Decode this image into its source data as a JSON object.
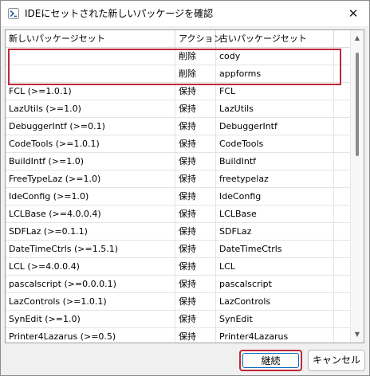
{
  "window": {
    "title": "IDEにセットされた新しいパッケージを確認",
    "close_glyph": "✕"
  },
  "table": {
    "headers": [
      "新しいパッケージセット",
      "アクション",
      "古いパッケージセット"
    ],
    "rows": [
      {
        "new": "",
        "action": "削除",
        "old": "cody"
      },
      {
        "new": "",
        "action": "削除",
        "old": "appforms"
      },
      {
        "new": "FCL (>=1.0.1)",
        "action": "保持",
        "old": "FCL"
      },
      {
        "new": "LazUtils (>=1.0)",
        "action": "保持",
        "old": "LazUtils"
      },
      {
        "new": "DebuggerIntf (>=0.1)",
        "action": "保持",
        "old": "DebuggerIntf"
      },
      {
        "new": "CodeTools (>=1.0.1)",
        "action": "保持",
        "old": "CodeTools"
      },
      {
        "new": "BuildIntf (>=1.0)",
        "action": "保持",
        "old": "BuildIntf"
      },
      {
        "new": "FreeTypeLaz (>=1.0)",
        "action": "保持",
        "old": "freetypelaz"
      },
      {
        "new": "IdeConfig (>=1.0)",
        "action": "保持",
        "old": "IdeConfig"
      },
      {
        "new": "LCLBase (>=4.0.0.4)",
        "action": "保持",
        "old": "LCLBase"
      },
      {
        "new": "SDFLaz (>=0.1.1)",
        "action": "保持",
        "old": "SDFLaz"
      },
      {
        "new": "DateTimeCtrls (>=1.5.1)",
        "action": "保持",
        "old": "DateTimeCtrls"
      },
      {
        "new": "LCL (>=4.0.0.4)",
        "action": "保持",
        "old": "LCL"
      },
      {
        "new": "pascalscript (>=0.0.0.1)",
        "action": "保持",
        "old": "pascalscript"
      },
      {
        "new": "LazControls (>=1.0.1)",
        "action": "保持",
        "old": "LazControls"
      },
      {
        "new": "SynEdit (>=1.0)",
        "action": "保持",
        "old": "SynEdit"
      },
      {
        "new": "Printer4Lazarus (>=0.5)",
        "action": "保持",
        "old": "Printer4Lazarus"
      },
      {
        "new": "",
        "action": "",
        "old": ""
      }
    ]
  },
  "buttons": {
    "continue_label": "継続",
    "cancel_label": "キャンセル"
  },
  "icons": {
    "app": "lazarus-app-icon",
    "scroll_up": "chevron-up-icon",
    "scroll_down": "chevron-down-icon"
  },
  "colors": {
    "highlight": "#c0283a",
    "focus": "#0067c0"
  }
}
